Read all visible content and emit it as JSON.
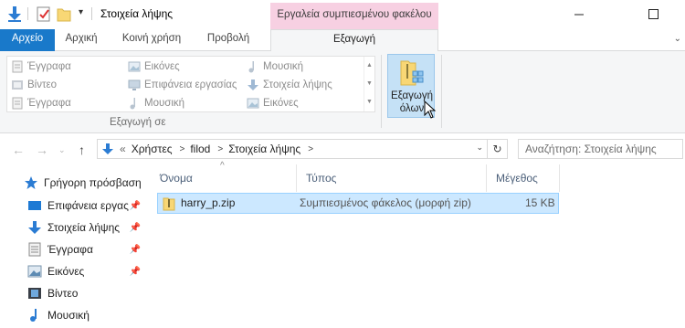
{
  "window": {
    "title": "Στοιχεία λήψης",
    "context_header": "Εργαλεία συμπιεσμένου φακέλου"
  },
  "tabs": {
    "file": "Αρχείο",
    "home": "Αρχική",
    "share": "Κοινή χρήση",
    "view": "Προβολή",
    "extract": "Εξαγωγή"
  },
  "ribbon": {
    "destinations": [
      {
        "label": "Έγγραφα",
        "icon": "documents-icon"
      },
      {
        "label": "Εικόνες",
        "icon": "pictures-icon"
      },
      {
        "label": "Μουσική",
        "icon": "music-icon"
      },
      {
        "label": "Βίντεο",
        "icon": "videos-icon"
      },
      {
        "label": "Επιφάνεια εργασίας",
        "icon": "desktop-icon"
      },
      {
        "label": "Στοιχεία λήψης",
        "icon": "downloads-icon"
      },
      {
        "label": "Έγγραφα",
        "icon": "documents-icon"
      },
      {
        "label": "Μουσική",
        "icon": "music-icon"
      },
      {
        "label": "Εικόνες",
        "icon": "pictures-icon"
      }
    ],
    "group_label": "Εξαγωγή σε",
    "extract_all_line1": "Εξαγωγή",
    "extract_all_line2": "όλων"
  },
  "address": {
    "prefix": "«",
    "crumbs": [
      "Χρήστες",
      "filod",
      "Στοιχεία λήψης"
    ],
    "search_placeholder": "Αναζήτηση: Στοιχεία λήψης"
  },
  "nav_pane": {
    "quick_access": "Γρήγορη πρόσβαση",
    "items": [
      {
        "label": "Επιφάνεια εργας",
        "icon": "desktop-icon",
        "pinned": true
      },
      {
        "label": "Στοιχεία λήψης",
        "icon": "downloads-icon",
        "pinned": true
      },
      {
        "label": "Έγγραφα",
        "icon": "documents-icon",
        "pinned": true
      },
      {
        "label": "Εικόνες",
        "icon": "pictures-icon",
        "pinned": true
      },
      {
        "label": "Βίντεο",
        "icon": "videos-icon",
        "pinned": false
      },
      {
        "label": "Μουσική",
        "icon": "music-icon",
        "pinned": false
      }
    ]
  },
  "file_list": {
    "columns": {
      "name": "Όνομα",
      "type": "Τύπος",
      "size": "Μέγεθος"
    },
    "rows": [
      {
        "name": "harry_p.zip",
        "type": "Συμπιεσμένος φάκελος (μορφή zip)",
        "size": "15 KB"
      }
    ]
  },
  "colors": {
    "accent": "#1979ca",
    "context_tab": "#f7d0e2",
    "selection": "#cce8ff"
  }
}
